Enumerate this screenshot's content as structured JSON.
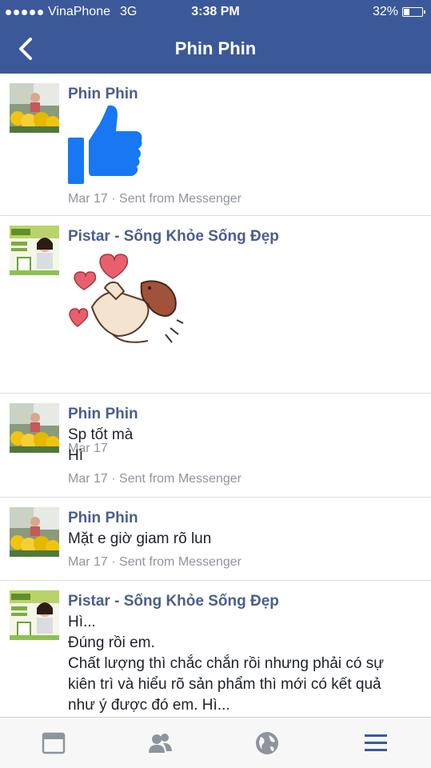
{
  "status": {
    "carrier": "VinaPhone",
    "network": "3G",
    "time": "3:38 PM",
    "battery_text": "32%",
    "battery_level": 0.32
  },
  "nav": {
    "title": "Phin Phin",
    "back_icon": "chevron-left-icon"
  },
  "messages": [
    {
      "sender": "Phin Phin",
      "meta": "Mar 17 · Sent from Messenger",
      "content": "thumbs-up-sticker"
    },
    {
      "sender": "Pistar - Sống Khỏe Sống Đẹp",
      "meta": "Mar 17",
      "content": "love-sticker"
    },
    {
      "sender": "Phin Phin",
      "lines": [
        "Sp tốt mà",
        "Hì"
      ],
      "meta": "Mar 17 · Sent from Messenger"
    },
    {
      "sender": "Phin Phin",
      "lines": [
        "Mặt e giờ giam rõ lun"
      ],
      "meta": "Mar 17 · Sent from Messenger"
    },
    {
      "sender": "Pistar - Sống Khỏe Sống Đẹp",
      "lines": [
        "Hì...",
        "Đúng rồi em.",
        "Chất lượng thì chắc chắn rồi nhưng phải có sự",
        "kiên trì và hiểu rõ sản phẩm thì mới có kết quả",
        "như ý được đó em. Hì..."
      ]
    }
  ],
  "tabbar": {
    "icons": [
      "news-feed-icon",
      "friends-icon",
      "globe-icon",
      "menu-icon"
    ]
  },
  "colors": {
    "header": "#3b5998",
    "sender": "#4b5e8c",
    "like": "#1877f2"
  }
}
